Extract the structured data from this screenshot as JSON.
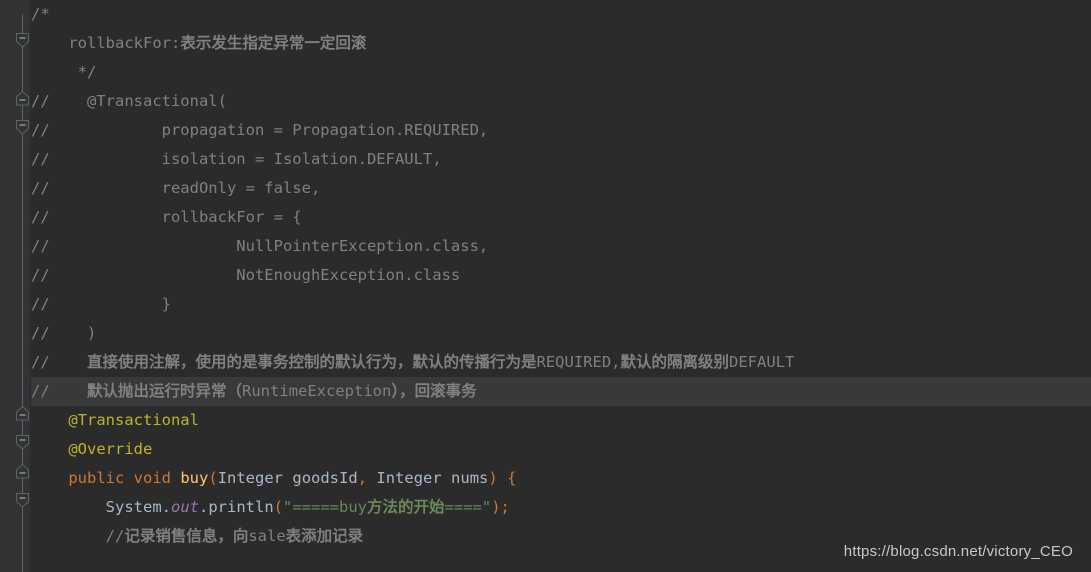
{
  "editor": {
    "theme_name": "darcula",
    "background_color": "#2b2b2b",
    "gutter_color": "#313335",
    "current_line_color": "#37393b",
    "line_height_px": 29,
    "current_line_index": 13,
    "colors": {
      "comment": "#808080",
      "comment_cjk": "#9a9a9a",
      "annotation": "#bbb529",
      "keyword": "#cc7832",
      "method": "#ffc66d",
      "string": "#6a8759",
      "field_static": "#9876aa",
      "default_text": "#a9b7c6",
      "fold_marker": "#606366"
    }
  },
  "gutter": {
    "fold_markers": [
      {
        "type": "fold-start-icon",
        "line": 1,
        "state": "expanded"
      },
      {
        "type": "fold-end-icon",
        "line": 3,
        "state": "expanded"
      },
      {
        "type": "fold-start-icon",
        "line": 4,
        "state": "expanded"
      },
      {
        "type": "fold-end-icon",
        "line": 14,
        "state": "expanded"
      },
      {
        "type": "fold-start-icon",
        "line": 15,
        "state": "expanded"
      },
      {
        "type": "fold-end-icon",
        "line": 16,
        "state": "expanded"
      },
      {
        "type": "fold-start-icon",
        "line": 17,
        "state": "expanded"
      }
    ]
  },
  "code": {
    "language": "java",
    "lines": [
      {
        "index": 0,
        "indent": 4,
        "text": "/*"
      },
      {
        "index": 1,
        "indent": 4,
        "text": "rollbackFor:表示发生指定异常一定回滚"
      },
      {
        "index": 2,
        "indent": 5,
        "text": "*/"
      },
      {
        "index": 3,
        "indent": 0,
        "text": "//    @Transactional("
      },
      {
        "index": 4,
        "indent": 0,
        "text": "//            propagation = Propagation.REQUIRED,"
      },
      {
        "index": 5,
        "indent": 0,
        "text": "//            isolation = Isolation.DEFAULT,"
      },
      {
        "index": 6,
        "indent": 0,
        "text": "//            readOnly = false,"
      },
      {
        "index": 7,
        "indent": 0,
        "text": "//            rollbackFor = {"
      },
      {
        "index": 8,
        "indent": 0,
        "text": "//                    NullPointerException.class,"
      },
      {
        "index": 9,
        "indent": 0,
        "text": "//                    NotEnoughException.class"
      },
      {
        "index": 10,
        "indent": 0,
        "text": "//            }"
      },
      {
        "index": 11,
        "indent": 0,
        "text": "//    )"
      },
      {
        "index": 12,
        "indent": 0,
        "text": "//    直接使用注解，使用的是事务控制的默认行为，默认的传播行为是REQUIRED,默认的隔离级别DEFAULT"
      },
      {
        "index": 13,
        "indent": 0,
        "text": "//    默认抛出运行时异常（RuntimeException），回滚事务"
      },
      {
        "index": 14,
        "indent": 4,
        "text": "@Transactional"
      },
      {
        "index": 15,
        "indent": 4,
        "text": "@Override"
      },
      {
        "index": 16,
        "indent": 4,
        "text": "public void buy(Integer goodsId, Integer nums) {"
      },
      {
        "index": 17,
        "indent": 8,
        "text": "System.out.println(\"=====buy方法的开始====\");"
      },
      {
        "index": 18,
        "indent": 8,
        "text": "//记录销售信息，向sale表添加记录"
      }
    ],
    "tokens": {
      "annotation_transactional": "@Transactional",
      "annotation_override": "@Override",
      "keyword_public": "public",
      "keyword_void": "void",
      "method_buy": "buy",
      "type_integer": "Integer",
      "param_goods_id": "goodsId",
      "param_nums": "nums",
      "class_system": "System",
      "field_out": "out",
      "method_println": "println",
      "string_buy_start": "\"=====buy方法的开始====\"",
      "comment_sale_record": "//记录销售信息，向sale表添加记录"
    }
  },
  "watermark": {
    "url": "https://blog.csdn.net/victory_CEO"
  }
}
